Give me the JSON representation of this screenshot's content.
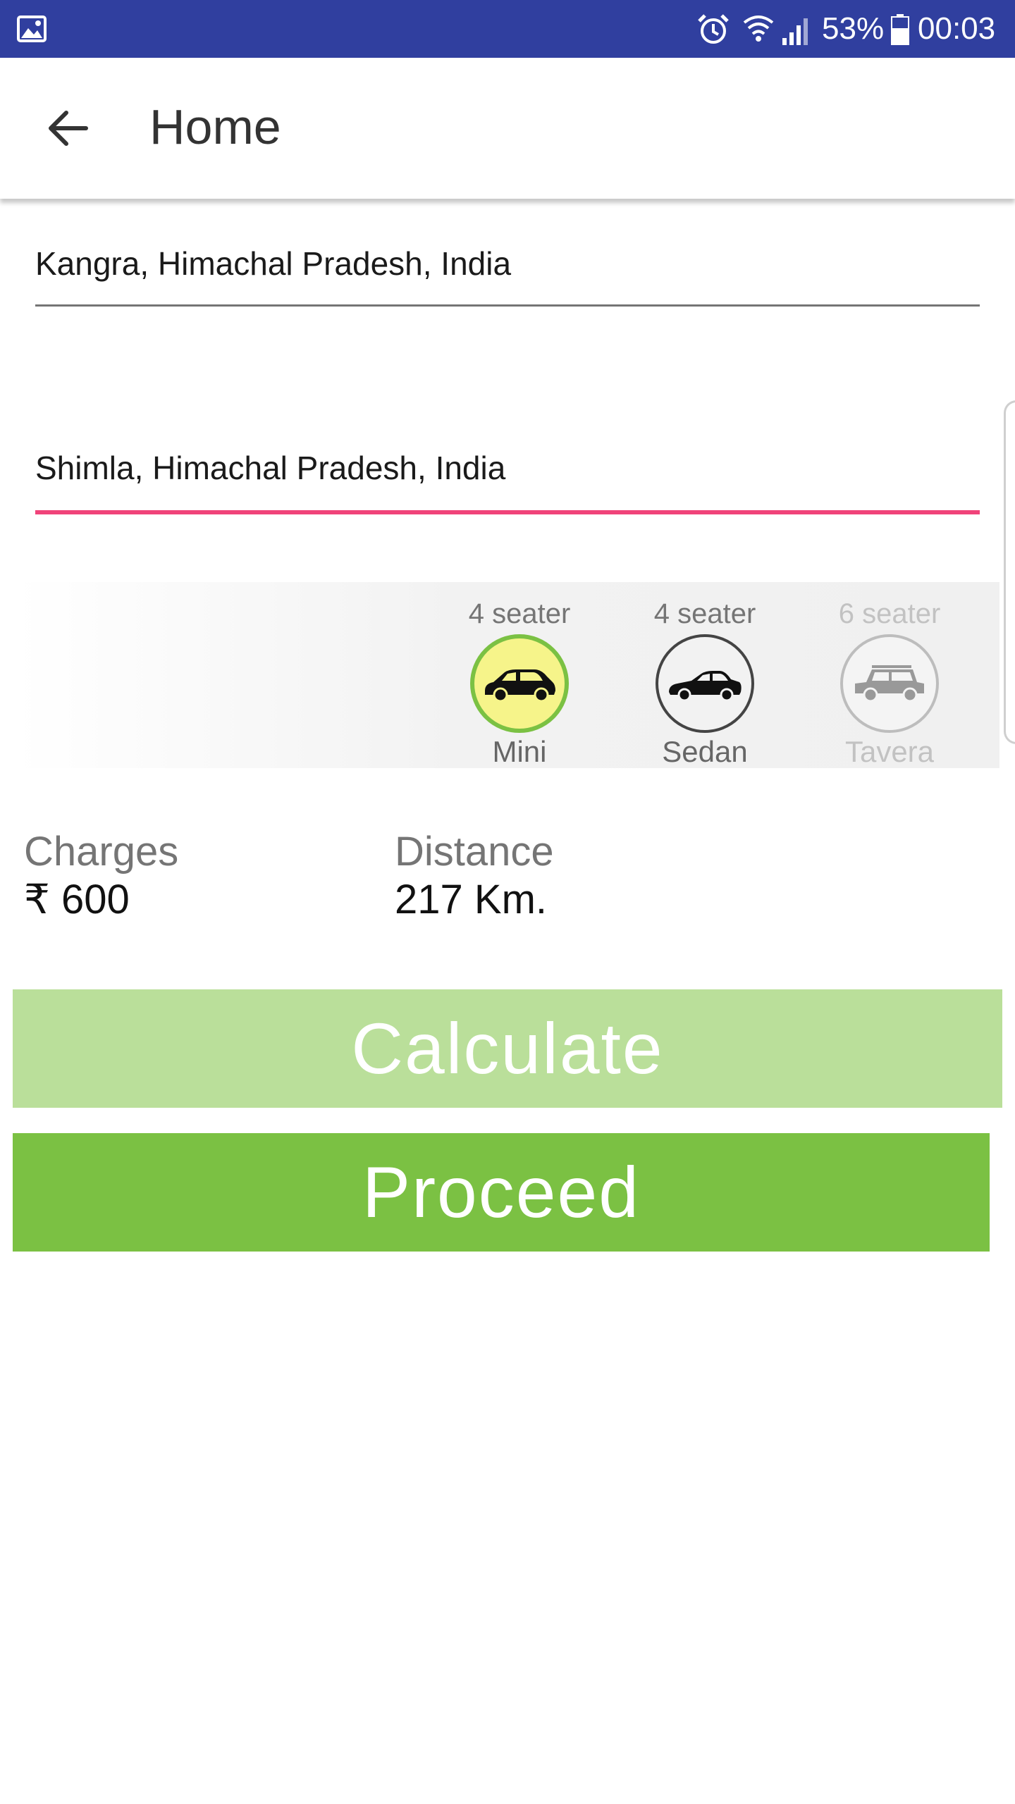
{
  "status_bar": {
    "battery": "53%",
    "time": "00:03",
    "icons": [
      "gallery-icon",
      "alarm-icon",
      "wifi-icon",
      "signal-icon",
      "battery-icon"
    ]
  },
  "app_bar": {
    "title": "Home",
    "back_icon": "arrow-back-icon"
  },
  "from_field": {
    "value": "Kangra, Himachal Pradesh, India"
  },
  "to_field": {
    "value": "Shimla, Himachal Pradesh, India"
  },
  "cars": [
    {
      "seats": "4 seater",
      "name": "Mini",
      "icon": "hatchback-icon",
      "selected": true
    },
    {
      "seats": "4 seater",
      "name": "Sedan",
      "icon": "sedan-icon",
      "selected": false
    },
    {
      "seats": "6 seater",
      "name": "Tavera",
      "icon": "suv-icon",
      "selected": false
    }
  ],
  "info": {
    "charges_label": "Charges",
    "charges_value": "₹ 600",
    "distance_label": "Distance",
    "distance_value": "217 Km."
  },
  "buttons": {
    "calculate": "Calculate",
    "proceed": "Proceed"
  },
  "colors": {
    "status_bar": "#303f9f",
    "accent_underline": "#f0437a",
    "proceed_green": "#7bc143",
    "calculate_green": "#badf9a",
    "selected_car_fill": "#f6f48a"
  }
}
